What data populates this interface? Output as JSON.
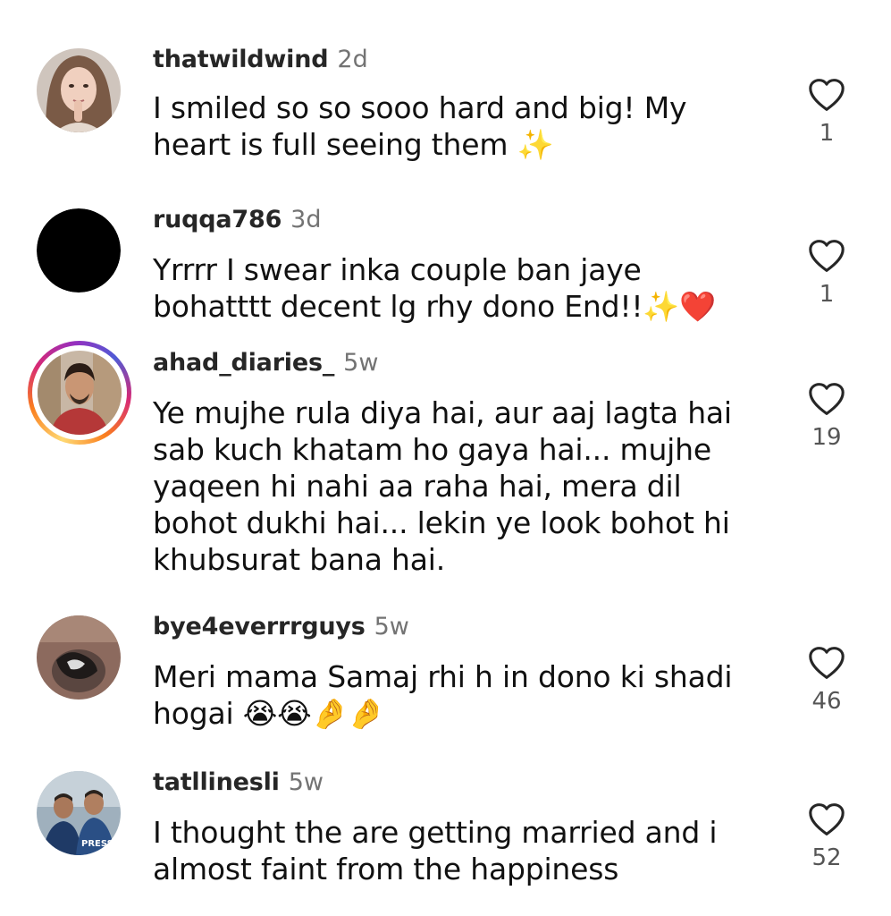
{
  "comments": [
    {
      "username": "thatwildwind",
      "time": "2d",
      "text": "I smiled so so sooo hard and big! My heart is full seeing them ✨",
      "likes": "1",
      "avatar": "woman-portrait"
    },
    {
      "username": "ruqqa786",
      "time": "3d",
      "text": "Yrrrr I swear inka couple ban jaye bohatttt decent lg rhy dono End!!✨❤️",
      "likes": "1",
      "avatar": "black-circle"
    },
    {
      "username": "ahad_diaries_",
      "time": "5w",
      "text": "Ye mujhe rula diya hai, aur aaj lagta hai sab kuch khatam ho gaya hai... mujhe yaqeen hi nahi aa raha hai, mera dil bohot dukhi hai... lekin ye look bohot hi khubsurat bana hai.",
      "likes": "19",
      "avatar": "man-portrait-story-ring"
    },
    {
      "username": "bye4everrrguys",
      "time": "5w",
      "text": "Meri mama Samaj rhi h in dono ki shadi hogai 😭😭🤌🤌",
      "likes": "46",
      "avatar": "masked-figure"
    },
    {
      "username": "tatllinesli",
      "time": "5w",
      "text": "I thought the are getting married and i almost faint from the happiness",
      "likes": "52",
      "avatar": "two-men-press",
      "avatar_text": "PRESS"
    }
  ],
  "colors": {
    "username": "#262626",
    "timestamp": "#737373",
    "text": "#111111",
    "heart_outline": "#262626"
  },
  "icons": {
    "like": "heart-outline-icon"
  }
}
